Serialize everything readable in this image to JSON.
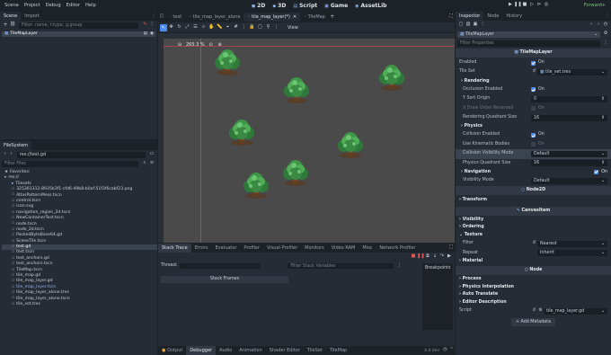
{
  "menubar": {
    "menus": [
      "Scene",
      "Project",
      "Debug",
      "Editor",
      "Help"
    ],
    "workspaces": [
      {
        "label": "2D",
        "icon": "2d-icon",
        "active": true
      },
      {
        "label": "3D",
        "icon": "3d-icon"
      },
      {
        "label": "Script",
        "icon": "script-icon"
      },
      {
        "label": "Game",
        "icon": "game-icon"
      },
      {
        "label": "AssetLib",
        "icon": "assetlib-icon"
      }
    ],
    "renderer": "Forward+"
  },
  "scene_dock": {
    "tabs": [
      "Scene",
      "Import"
    ],
    "filter_placeholder": "Filter: name, t:type, g:group",
    "root_node": "TileMapLayer"
  },
  "filesystem": {
    "title": "FileSystem",
    "path": "res://test.gd",
    "filter_placeholder": "Filter Files",
    "items": [
      {
        "label": "Favorites:",
        "indent": 0
      },
      {
        "label": "res://",
        "indent": 0,
        "folder": true
      },
      {
        "label": "Tilesets",
        "indent": 1,
        "folder": true
      },
      {
        "label": "325361312-8935b3f1-cfd6-49b8-b0af-51f3f6cabf23.png",
        "indent": 1
      },
      {
        "label": "AtlasPatternMess.tscn",
        "indent": 1
      },
      {
        "label": "control.tscn",
        "indent": 1
      },
      {
        "label": "icon.svg",
        "indent": 1
      },
      {
        "label": "navigation_region_2d.tscn",
        "indent": 1
      },
      {
        "label": "NewContainerTest.tscn",
        "indent": 1
      },
      {
        "label": "node.tscn",
        "indent": 1
      },
      {
        "label": "node_2d.tscn",
        "indent": 1
      },
      {
        "label": "PackedByteBase64.gd",
        "indent": 1
      },
      {
        "label": "SceneTile.tscn",
        "indent": 1
      },
      {
        "label": "test.gd",
        "indent": 1,
        "selected": true
      },
      {
        "label": "test.tscn",
        "indent": 1
      },
      {
        "label": "test_anchors.gd",
        "indent": 1
      },
      {
        "label": "test_anchors.tscn",
        "indent": 1
      },
      {
        "label": "TileMap.tscn",
        "indent": 1
      },
      {
        "label": "tile_map.gd",
        "indent": 1
      },
      {
        "label": "tile_map_layer.gd",
        "indent": 1
      },
      {
        "label": "tile_map_layer.tscn",
        "indent": 1,
        "highlight": true
      },
      {
        "label": "tile_map_layer_alone.tres",
        "indent": 1
      },
      {
        "label": "tile_map_layer_alone.tscn",
        "indent": 1
      },
      {
        "label": "tile_set.tres",
        "indent": 1
      }
    ]
  },
  "editor_tabs": [
    "test",
    "tile_map_layer_alone",
    "tile_map_layer(*)",
    "TileMap"
  ],
  "toolbar": {
    "view_label": "View"
  },
  "viewport": {
    "zoom": "265.3 %"
  },
  "bottom": {
    "tabs": [
      "Stack Trace",
      "Errors",
      "Evaluator",
      "Profiler",
      "Visual Profiler",
      "Monitors",
      "Video RAM",
      "Misc",
      "Network Profiler"
    ],
    "thread_label": "Thread:",
    "filter_placeholder": "Filter Stack Variables",
    "breakpoints_label": "Breakpoints",
    "stack_frames_label": "Stack Frames",
    "status_tabs": [
      "Output",
      "Debugger",
      "Audio",
      "Animation",
      "Shader Editor",
      "TileSet",
      "TileMap"
    ],
    "version": "4.4.dev"
  },
  "inspector": {
    "tabs": [
      "Inspector",
      "Node",
      "History"
    ],
    "object_name": "TileMapLayer",
    "filter_placeholder": "Filter Properties",
    "class_name": "TileMapLayer",
    "enabled_label": "Enabled",
    "on_label": "On",
    "tile_set_label": "Tile Set",
    "tile_set_value": "tile_set.tres",
    "rendering_header": "Rendering",
    "rendering_rows": [
      {
        "label": "Occlusion Enabled",
        "kind": "check",
        "on": true
      },
      {
        "label": "Y Sort Origin",
        "kind": "num",
        "value": "0"
      },
      {
        "label": "X Draw Order Reversed",
        "kind": "check",
        "on": false,
        "dim": true
      },
      {
        "label": "Rendering Quadrant Size",
        "kind": "num",
        "value": "16"
      }
    ],
    "physics_header": "Physics",
    "physics_rows": [
      {
        "label": "Collision Enabled",
        "kind": "check",
        "on": true
      },
      {
        "label": "Use Kinematic Bodies",
        "kind": "check",
        "on": false
      },
      {
        "label": "Collision Visibility Mode",
        "kind": "dropdown",
        "value": "Default",
        "selected": true
      },
      {
        "label": "Physics Quadrant Size",
        "kind": "num",
        "value": "16"
      }
    ],
    "navigation_header": "Navigation",
    "visibility_mode_label": "Visibility Mode",
    "visibility_mode_value": "Default",
    "node2d_header": "Node2D",
    "transform_label": "Transform",
    "canvasitem_header": "CanvasItem",
    "canvas_sections": [
      "Visibility",
      "Ordering",
      "Texture"
    ],
    "filter_label": "Filter",
    "filter_value": "Nearest",
    "repeat_label": "Repeat",
    "repeat_value": "Inherit",
    "material_label": "Material",
    "node_header": "Node",
    "node_sections": [
      "Process",
      "Physics Interpolation",
      "Auto Translate",
      "Editor Description"
    ],
    "script_label": "Script",
    "script_value": "tile_map_layer.gd",
    "add_metadata_label": "Add Metadata"
  },
  "colors": {
    "accent": "#4a8ef5",
    "background": "#1d2229",
    "panel": "#262c35",
    "canvas": "#4a4a4a"
  }
}
